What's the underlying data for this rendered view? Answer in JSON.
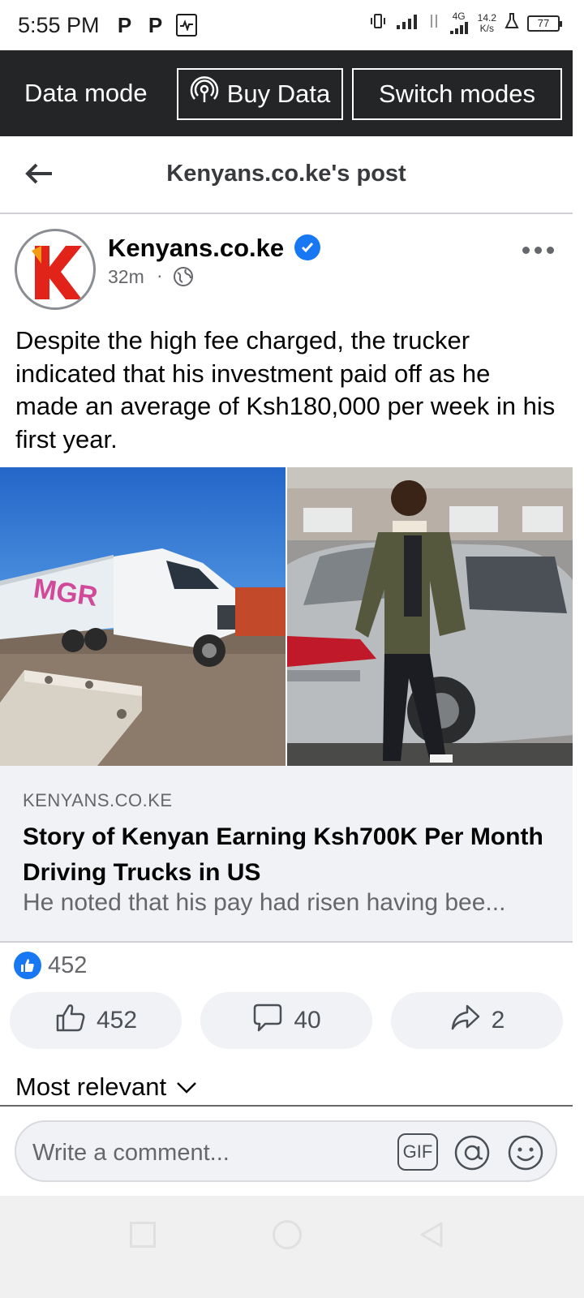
{
  "status_bar": {
    "time": "5:55 PM",
    "app_icon_1": "P",
    "app_icon_2": "P",
    "network_type": "4G",
    "speed_value": "14.2",
    "speed_unit": "K/s",
    "battery": "77"
  },
  "data_bar": {
    "mode_label": "Data mode",
    "buy_label": "Buy Data",
    "switch_label": "Switch modes"
  },
  "header": {
    "title": "Kenyans.co.ke's post"
  },
  "post": {
    "author": "Kenyans.co.ke",
    "time": "32m",
    "separator": "·",
    "text": "Despite the high fee charged, the trucker indicated that his investment paid off as he made an average of Ksh180,000 per week in his first year.",
    "truck_brand": "MGR"
  },
  "link_preview": {
    "domain": "KENYANS.CO.KE",
    "title": "Story of Kenyan Earning Ksh700K Per Month Driving Trucks in US",
    "description": "He noted that his pay had risen having bee..."
  },
  "reactions": {
    "count": "452"
  },
  "actions": {
    "like_count": "452",
    "comment_count": "40",
    "share_count": "2"
  },
  "comments": {
    "sort_label": "Most relevant",
    "input_placeholder": "Write a comment...",
    "gif_label": "GIF"
  },
  "colors": {
    "facebook_blue": "#1877f2",
    "data_bar_bg": "#242526",
    "secondary_text": "#65676b",
    "preview_bg": "#f0f2f5"
  }
}
